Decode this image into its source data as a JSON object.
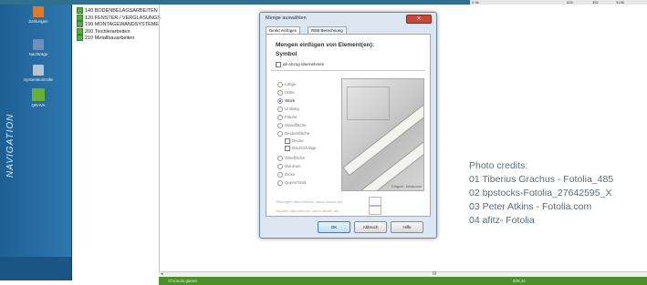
{
  "top_strip": {
    "cells": [
      "2.36",
      "525",
      "352",
      "3136"
    ]
  },
  "nav": {
    "title": "NAVIGATION",
    "items": [
      {
        "label": "Zahlungen",
        "icon": "payments-icon",
        "color": "#e07a2a"
      },
      {
        "label": "Nachträge",
        "icon": "addendum-icon",
        "color": "#6f8fbd"
      },
      {
        "label": "Systemkontrolle",
        "icon": "system-check-icon",
        "color": "#b7c4d2"
      },
      {
        "label": "QRAVA",
        "icon": "qrava-icon",
        "color": "#68b03a"
      }
    ]
  },
  "tree": {
    "items": [
      "140 BODENBELAGSARBEITEN",
      "120 FENSTER / VERGLASUNGS",
      "190 MONTAGEWANDSYSTEME",
      "200 Tischlerarbeiten",
      "210 Metallbauarbeiten"
    ]
  },
  "dialog": {
    "title": "Menge auswählen",
    "tabs": [
      "Direkt einfügen",
      "REB Berechnung"
    ],
    "heading_line1": "Mengen einfügen von Element(en):",
    "heading_line2": "Symbol",
    "checkbox_label": "ab Abzug übernehmen",
    "options": [
      "Länge",
      "Höhe",
      "Stück",
      "Umfang",
      "Fläche",
      "Wandfläche",
      "Deckenfläche",
      "Decke",
      "Dachschräge",
      "Oberfläche",
      "Volumen",
      "Dicke",
      "Querschnitt"
    ],
    "selected_option": "Stück",
    "photo_caption": "© fagcm - fotolia.com",
    "footer_line1": "Öffnungen übernehmen, wenn kleiner als",
    "footer_line2": "Nischen übernehmen, wenn kleiner als",
    "buttons": {
      "ok": "OK",
      "cancel": "Abbruch",
      "help": "Hilfe"
    }
  },
  "status_bar": {
    "left": "Chronolo gieren",
    "right": "828,44"
  },
  "hscroll_marker": "III",
  "credits": {
    "heading": "Photo credits:",
    "lines": [
      "01 Tiberius Grachus - Fotolia_485",
      "02 bpstocks-Fotolia_27642595_X",
      "03 Peter Atkins - Fotolia.com",
      "04 afitz- Fotolia"
    ]
  }
}
